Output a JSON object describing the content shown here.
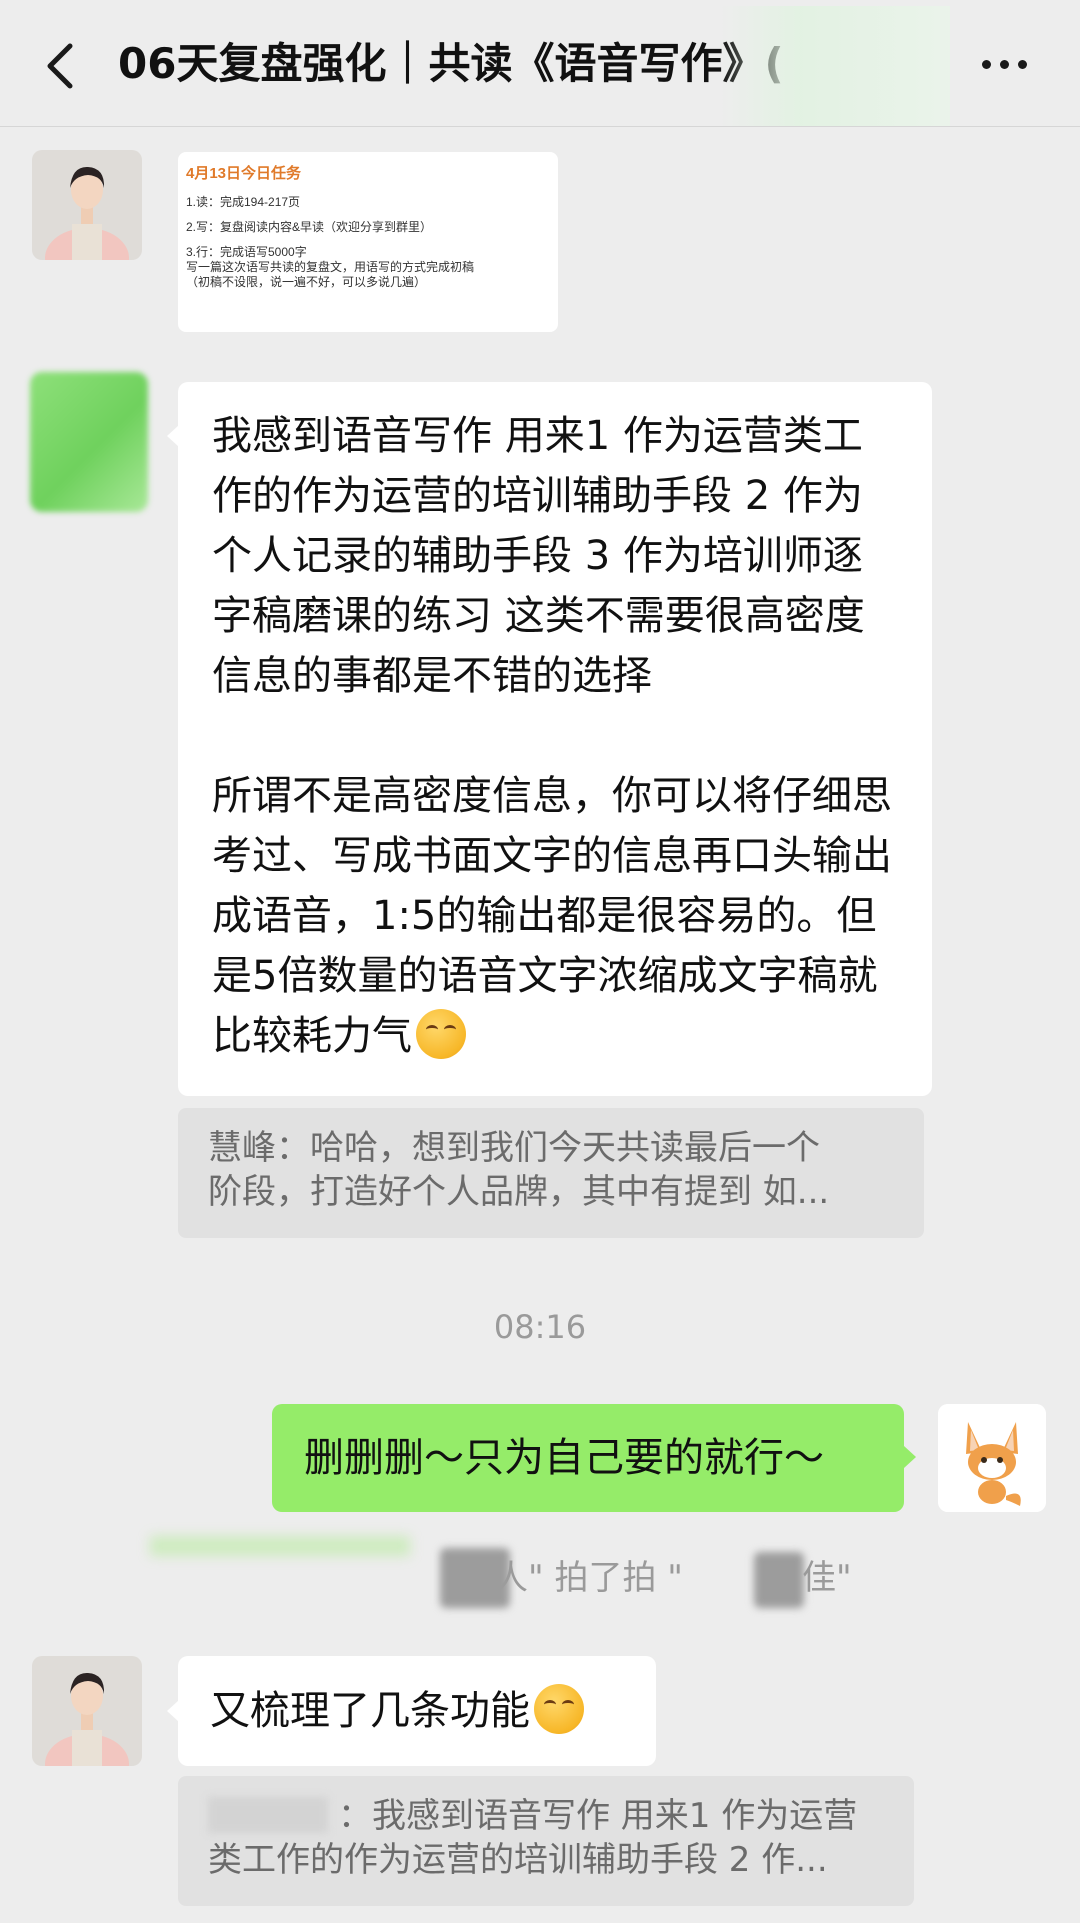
{
  "header": {
    "title": "06天复盘强化｜共读《语音写作》("
  },
  "messages": {
    "image_card": {
      "title": "4月13日今日任务",
      "line1": "1.读：完成194-217页",
      "line2": "2.写：复盘阅读内容&早读（欢迎分享到群里）",
      "line3": "3.行：完成语写5000字",
      "line3_sub1": "写一篇这次语写共读的复盘文，用语写的方式完成初稿",
      "line3_sub2": "（初稿不设限，说一遍不好，可以多说几遍）"
    },
    "long_text": {
      "para1": "我感到语音写作 用来1 作为运营类工作的作为运营的培训辅助手段 2 作为个人记录的辅助手段 3 作为培训师逐字稿磨课的练习 这类不需要很高密度信息的事都是不错的选择",
      "para2": "所谓不是高密度信息，你可以将仔细思考过、写成书面文字的信息再口头输出成语音，1:5的输出都是很容易的。但是5倍数量的语音文字浓缩成文字稿就比较耗力气"
    },
    "quote1": {
      "line1": "慧峰：哈哈，想到我们今天共读最后一个",
      "line2": "阶段，打造好个人品牌，其中有提到  如..."
    },
    "timestamp": "08:16",
    "sent": {
      "text": "删删删～只为自己要的就行～"
    },
    "system_notice": {
      "part1": "人\" 拍了拍 \"",
      "part2": "佳\""
    },
    "reply": {
      "text": "又梳理了几条功能"
    },
    "quote2": {
      "line1": "：我感到语音写作 用来1 作为运营",
      "line2": "类工作的作为运营的培训辅助手段 2 作..."
    }
  }
}
